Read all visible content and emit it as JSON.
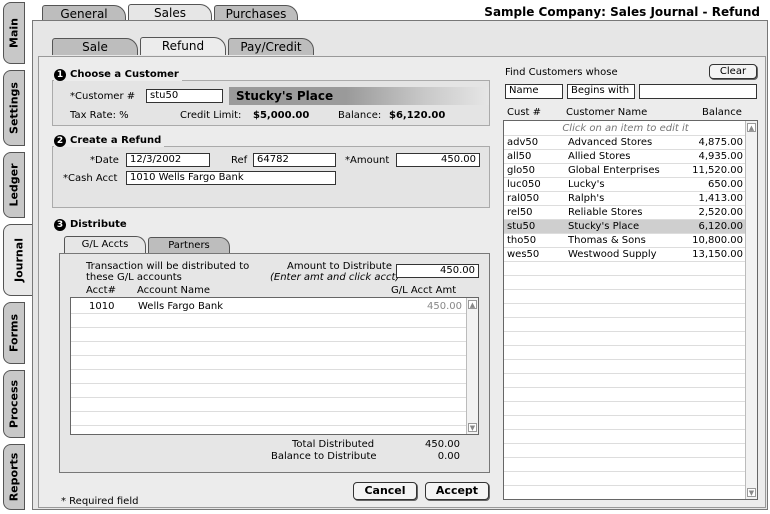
{
  "window_title": "Sample Company: Sales Journal - Refund",
  "side_tabs": [
    "Main",
    "Settings",
    "Ledger",
    "Journal",
    "Forms",
    "Process",
    "Reports"
  ],
  "top_tabs": [
    "General",
    "Sales",
    "Purchases"
  ],
  "sub_tabs": [
    "Sale",
    "Refund",
    "Pay/Credit"
  ],
  "customer": {
    "heading": "Choose a Customer",
    "customer_label": "*Customer #",
    "customer_value": "stu50",
    "customer_name": "Stucky's Place",
    "tax_rate": "Tax Rate: %",
    "credit_limit_label": "Credit Limit:",
    "credit_limit": "$5,000.00",
    "balance_label": "Balance:",
    "balance": "$6,120.00"
  },
  "refund": {
    "heading": "Create a Refund",
    "date_label": "*Date",
    "date_value": "12/3/2002",
    "ref_label": "Ref",
    "ref_value": "64782",
    "amount_label": "*Amount",
    "amount_value": "450.00",
    "cash_label": "*Cash Acct",
    "cash_value": "1010 Wells Fargo Bank"
  },
  "distribute": {
    "heading": "Distribute",
    "tabs": [
      "G/L Accts",
      "Partners"
    ],
    "note_line1": "Transaction will be distributed to",
    "note_line2": "these G/L accounts",
    "amount_label_line1": "Amount to Distribute",
    "amount_label_line2": "(Enter amt and click acct)",
    "amount_value": "450.00",
    "columns": [
      "Acct#",
      "Account Name",
      "G/L Acct Amt"
    ],
    "rows": [
      {
        "acct": "1010",
        "name": "Wells Fargo Bank",
        "amt": "450.00"
      }
    ],
    "total_label": "Total Distributed",
    "total_value": "450.00",
    "balance_label": "Balance to Distribute",
    "balance_value": "0.00"
  },
  "required_note": "* Required field",
  "buttons": {
    "cancel": "Cancel",
    "accept": "Accept",
    "clear": "Clear"
  },
  "find": {
    "label": "Find Customers whose",
    "field": "Name",
    "mode": "Begins with",
    "query": "",
    "columns": [
      "Cust #",
      "Customer Name",
      "Balance"
    ],
    "hint": "Click on an item to edit it",
    "rows": [
      {
        "id": "adv50",
        "name": "Advanced Stores",
        "balance": "4,875.00"
      },
      {
        "id": "all50",
        "name": "Allied Stores",
        "balance": "4,935.00"
      },
      {
        "id": "glo50",
        "name": "Global Enterprises",
        "balance": "11,520.00"
      },
      {
        "id": "luc050",
        "name": "Lucky's",
        "balance": "650.00"
      },
      {
        "id": "ral050",
        "name": "Ralph's",
        "balance": "1,413.00"
      },
      {
        "id": "rel50",
        "name": "Reliable Stores",
        "balance": "2,520.00"
      },
      {
        "id": "stu50",
        "name": "Stucky's Place",
        "balance": "6,120.00"
      },
      {
        "id": "tho50",
        "name": "Thomas & Sons",
        "balance": "10,800.00"
      },
      {
        "id": "wes50",
        "name": "Westwood Supply",
        "balance": "13,150.00"
      }
    ]
  }
}
